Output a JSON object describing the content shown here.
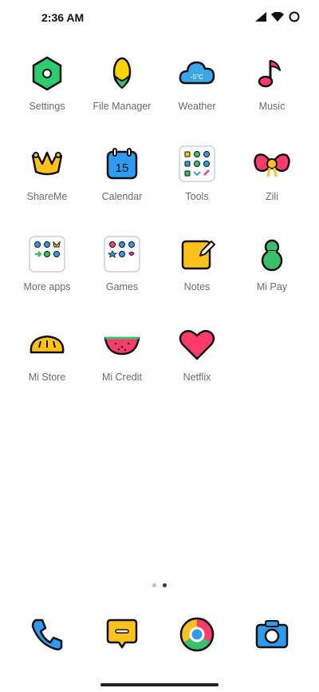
{
  "status": {
    "time": "2:36 AM"
  },
  "apps": [
    {
      "label": "Settings",
      "icon": "settings-icon"
    },
    {
      "label": "File Manager",
      "icon": "file-manager-icon"
    },
    {
      "label": "Weather",
      "icon": "weather-icon",
      "temp": "-5°C"
    },
    {
      "label": "Music",
      "icon": "music-icon"
    },
    {
      "label": "ShareMe",
      "icon": "shareme-icon"
    },
    {
      "label": "Calendar",
      "icon": "calendar-icon",
      "date": "15"
    },
    {
      "label": "Tools",
      "icon": "tools-folder-icon"
    },
    {
      "label": "Zili",
      "icon": "zili-icon"
    },
    {
      "label": "More apps",
      "icon": "more-apps-folder-icon"
    },
    {
      "label": "Games",
      "icon": "games-folder-icon"
    },
    {
      "label": "Notes",
      "icon": "notes-icon"
    },
    {
      "label": "Mi Pay",
      "icon": "mi-pay-icon"
    },
    {
      "label": "Mi Store",
      "icon": "mi-store-icon"
    },
    {
      "label": "Mi Credit",
      "icon": "mi-credit-icon"
    },
    {
      "label": "Netflix",
      "icon": "netflix-icon"
    }
  ],
  "page_indicator": {
    "pages": 2,
    "current": 2
  },
  "dock": [
    {
      "icon": "phone-icon"
    },
    {
      "icon": "messages-icon"
    },
    {
      "icon": "chrome-icon"
    },
    {
      "icon": "camera-icon"
    }
  ]
}
